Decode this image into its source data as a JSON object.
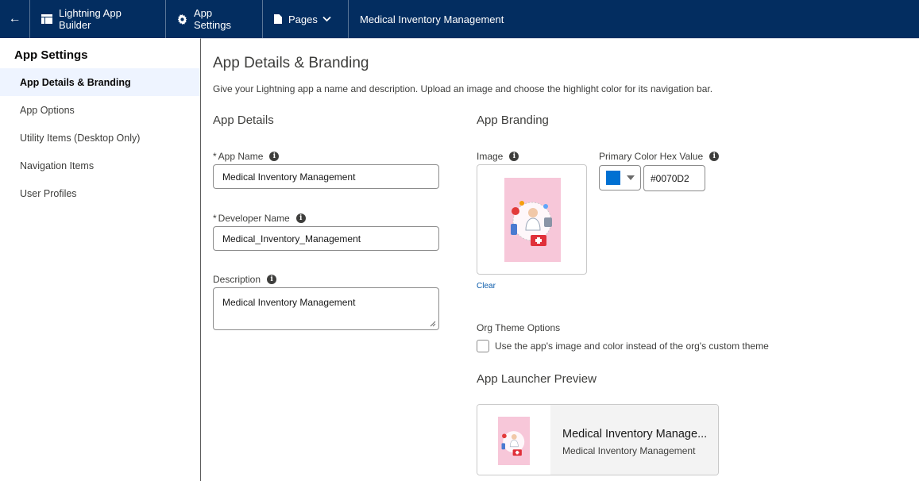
{
  "topbar": {
    "back_label": "←",
    "builder_label": "Lightning App Builder",
    "settings_label": "App Settings",
    "pages_label": "Pages",
    "app_title": "Medical Inventory Management"
  },
  "sidebar": {
    "title": "App Settings",
    "items": [
      {
        "label": "App Details & Branding",
        "active": true
      },
      {
        "label": "App Options",
        "active": false
      },
      {
        "label": "Utility Items (Desktop Only)",
        "active": false
      },
      {
        "label": "Navigation Items",
        "active": false
      },
      {
        "label": "User Profiles",
        "active": false
      }
    ]
  },
  "main": {
    "title": "App Details & Branding",
    "description": "Give your Lightning app a name and description. Upload an image and choose the highlight color for its navigation bar.",
    "details": {
      "heading": "App Details",
      "app_name_label": "App Name",
      "app_name_value": "Medical Inventory Management",
      "developer_name_label": "Developer Name",
      "developer_name_value": "Medical_Inventory_Management",
      "description_label": "Description",
      "description_value": "Medical Inventory Management",
      "required_mark": "*"
    },
    "branding": {
      "heading": "App Branding",
      "image_label": "Image",
      "clear_label": "Clear",
      "color_label": "Primary Color Hex Value",
      "color_value": "#0070D2",
      "swatch_color": "#0070d2",
      "org_theme_label": "Org Theme Options",
      "org_theme_checkbox_label": "Use the app's image and color instead of the org's custom theme",
      "org_theme_checked": false
    },
    "preview": {
      "heading": "App Launcher Preview",
      "app_name": "Medical Inventory Manage...",
      "app_description": "Medical Inventory Management"
    }
  },
  "icons": {
    "info": "i"
  }
}
